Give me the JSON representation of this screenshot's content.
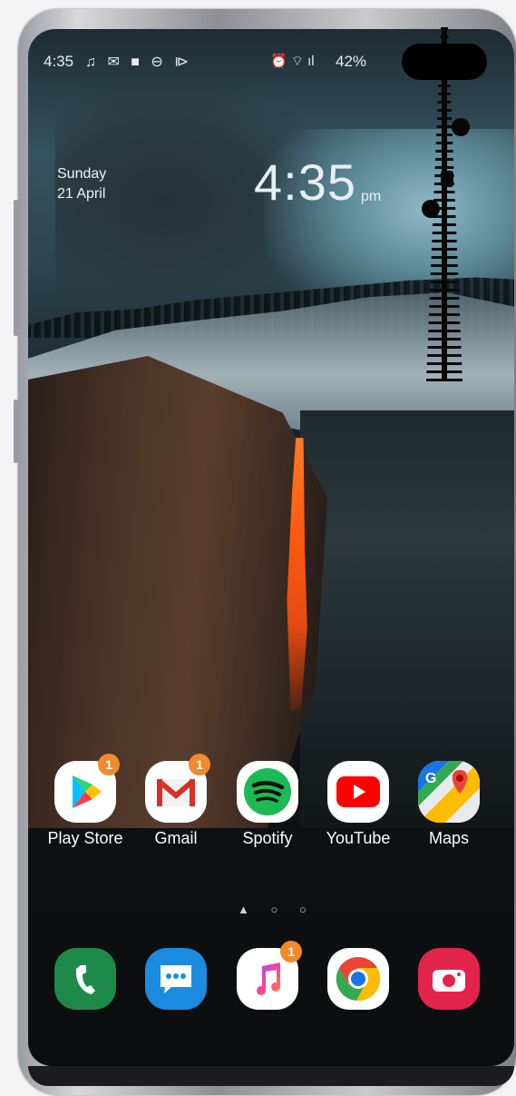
{
  "status_bar": {
    "time": "4:35",
    "left_icons": [
      "music-note-icon",
      "mail-icon",
      "video-icon",
      "dnd-icon",
      "play-icon"
    ],
    "left_icons_glyphs": "♫ ✉ ■ ⊖ ⧐",
    "right_icons_glyphs": "⏰ ⌔ ıl",
    "battery": "42%"
  },
  "clock": {
    "day": "Sunday",
    "date": "21 April",
    "time": "4:35",
    "ampm": "pm"
  },
  "apps": [
    {
      "label": "Play Store",
      "badge": "1",
      "icon": "play-store-icon"
    },
    {
      "label": "Gmail",
      "badge": "1",
      "icon": "gmail-icon"
    },
    {
      "label": "Spotify",
      "badge": "",
      "icon": "spotify-icon"
    },
    {
      "label": "YouTube",
      "badge": "",
      "icon": "youtube-icon"
    },
    {
      "label": "Maps",
      "badge": "",
      "icon": "maps-icon"
    }
  ],
  "page_indicator": "▲ ○ ○",
  "dock": [
    {
      "icon": "phone-icon",
      "badge": ""
    },
    {
      "icon": "messages-icon",
      "badge": ""
    },
    {
      "icon": "music-icon",
      "badge": "1"
    },
    {
      "icon": "chrome-icon",
      "badge": ""
    },
    {
      "icon": "camera-icon",
      "badge": ""
    }
  ],
  "colors": {
    "badge": "#f08a2c",
    "spotify": "#1db954",
    "youtube": "#ff0000",
    "phone": "#1e8a4a",
    "messages": "#1a8be0",
    "camera": "#e3244a"
  }
}
